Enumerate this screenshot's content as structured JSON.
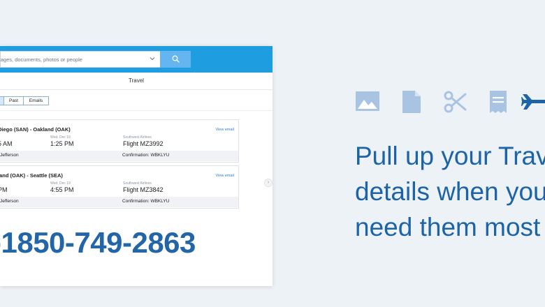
{
  "search": {
    "placeholder": "sages, documents, photos or people"
  },
  "page_title": "Travel",
  "tabs": [
    {
      "label": ""
    },
    {
      "label": "Past"
    },
    {
      "label": "Emails"
    }
  ],
  "trips": [
    {
      "route": "Diego (SAN) - Oakland (OAK)",
      "view_email": "View email",
      "dep_date": "",
      "dep_time": "5 AM",
      "arr_date": "Wed, Dec 19",
      "arr_time": "1:25 PM",
      "airline": "Southwest Airlines",
      "flight": "Flight MZ3992",
      "passenger": "Jefferson",
      "confirmation": "Confirmation: WBKLYU"
    },
    {
      "route": "land (OAK) - Seattle (SEA)",
      "view_email": "View email",
      "dep_date": "",
      "dep_time": "PM",
      "arr_date": "Wed, Dec 19",
      "arr_time": "4:55 PM",
      "airline": "Southwest Airlines",
      "flight": "Flight MZ3842",
      "passenger": "Jefferson",
      "confirmation": "Confirmation: WBKLYU"
    }
  ],
  "pager_glyph": "›",
  "phone": "-1850-749-2863",
  "headline": [
    "Pull up your Trav",
    "details when you",
    "need them most"
  ],
  "colors": {
    "brand_blue": "#1e9de0",
    "icon_blue": "#a9c4e2",
    "headline_blue": "#1d63a8"
  },
  "icons": [
    "image-icon",
    "document-icon",
    "scissors-icon",
    "receipt-icon",
    "airplane-icon"
  ]
}
